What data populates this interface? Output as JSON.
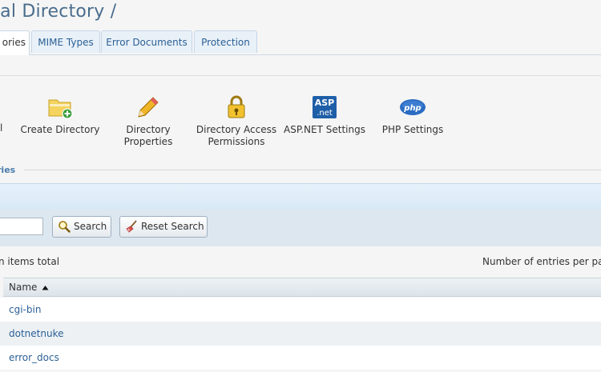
{
  "header": {
    "title": "ual Directory /"
  },
  "tabs": [
    {
      "label": "ories",
      "active": true
    },
    {
      "label": "MIME Types",
      "active": false
    },
    {
      "label": "Error Documents",
      "active": false
    },
    {
      "label": "Protection",
      "active": false
    }
  ],
  "toolbar": {
    "cut_label": "l",
    "create_directory": "Create Directory",
    "directory_properties": "Directory Properties",
    "directory_access": "Directory Access Permissions",
    "aspnet_settings": "ASP.NET Settings",
    "php_settings": "PHP Settings",
    "aspnet_icon_top": "ASP",
    "aspnet_icon_bottom": ".net",
    "php_icon_text": "php"
  },
  "section": {
    "label": "ries"
  },
  "search": {
    "value": "",
    "search_button": "Search",
    "reset_button": "Reset Search"
  },
  "list": {
    "items_total": "n items total",
    "per_page_label": "Number of entries per pag",
    "column_name": "Name",
    "rows": [
      {
        "name": "cgi-bin"
      },
      {
        "name": "dotnetnuke"
      },
      {
        "name": "error_docs"
      }
    ]
  },
  "colors": {
    "accent": "#2a5f95",
    "row_alt": "#edf1f4"
  }
}
